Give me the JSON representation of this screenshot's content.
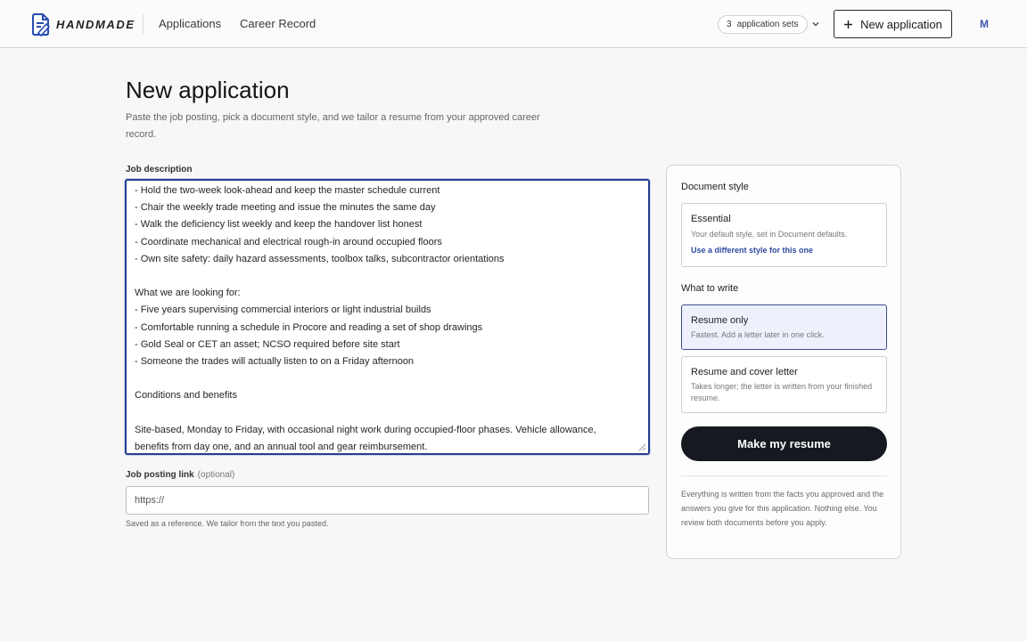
{
  "header": {
    "brand": "HANDMADE",
    "nav": [
      "Applications",
      "Career Record"
    ],
    "sets_count": "3",
    "sets_label": "application sets",
    "new_application_label": "New application",
    "avatar_initial": "M"
  },
  "page": {
    "title": "New application",
    "subtitle": "Paste the job posting, pick a document style, and we tailor a resume from your approved career record."
  },
  "job_description": {
    "label": "Job description",
    "lines": [
      "- Hold the two-week look-ahead and keep the master schedule current",
      "- Chair the weekly trade meeting and issue the minutes the same day",
      "- Walk the deficiency list weekly and keep the handover list honest",
      "- Coordinate mechanical and electrical rough-in around occupied floors",
      "- Own site safety: daily hazard assessments, toolbox talks, subcontractor orientations",
      "",
      "What we are looking for:",
      "- Five years supervising commercial interiors or light industrial builds",
      "- Comfortable running a schedule in Procore and reading a set of shop drawings",
      "- Gold Seal or CET an asset; NCSO required before site start",
      "- Someone the trades will actually listen to on a Friday afternoon",
      "",
      "Conditions and benefits",
      "",
      "Site-based, Monday to Friday, with occasional night work during occupied-floor phases. Vehicle allowance,",
      "benefits from day one, and an annual tool and gear reimbursement."
    ]
  },
  "job_posting_link": {
    "label": "Job posting link",
    "optional_label": "(optional)",
    "placeholder": "https://",
    "help": "Saved as a reference. We tailor from the text you pasted."
  },
  "panel": {
    "document_style_heading": "Document style",
    "style_card": {
      "title": "Essential",
      "description": "Your default style, set in Document defaults.",
      "link": "Use a different style for this one"
    },
    "what_to_write_heading": "What to write",
    "options": [
      {
        "title": "Resume only",
        "description": "Fastest. Add a letter later in one click.",
        "selected": true
      },
      {
        "title": "Resume and cover letter",
        "description": "Takes longer; the letter is written from your finished resume.",
        "selected": false
      }
    ],
    "primary_button": "Make my resume",
    "note": "Everything is written from the facts you approved and the answers you give for this application. Nothing else. You review both documents before you apply."
  },
  "colors": {
    "accent": "#243f8f",
    "selected_bg": "#eef1fc",
    "primary_button": "#161a20",
    "link": "#2f4aa0"
  }
}
